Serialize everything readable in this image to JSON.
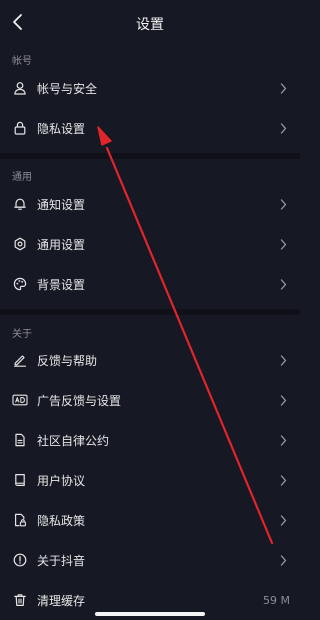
{
  "header": {
    "title": "设置"
  },
  "sections": {
    "account": "帐号",
    "general": "通用",
    "about": "关于"
  },
  "rows": {
    "account_security": "帐号与安全",
    "privacy_settings": "隐私设置",
    "notification_settings": "通知设置",
    "general_settings": "通用设置",
    "background_settings": "背景设置",
    "feedback_help": "反馈与帮助",
    "ad_feedback_settings": "广告反馈与设置",
    "community_guidelines": "社区自律公约",
    "user_agreement": "用户协议",
    "privacy_policy": "隐私政策",
    "about_douyin": "关于抖音",
    "clear_cache": "清理缓存",
    "cache_size": "59 M"
  },
  "icons": {
    "back": "chevron-left-icon",
    "account_security": "user-icon",
    "privacy_settings": "lock-icon",
    "notification_settings": "bell-icon",
    "general_settings": "gear-icon",
    "background_settings": "palette-icon",
    "feedback_help": "pencil-icon",
    "ad_feedback_settings": "ad-icon",
    "community_guidelines": "document-icon",
    "user_agreement": "book-icon",
    "privacy_policy": "document-lock-icon",
    "about_douyin": "info-icon",
    "clear_cache": "trash-icon",
    "chevron": "chevron-right-icon"
  },
  "colors": {
    "background": "#161823",
    "divider": "#0f1018",
    "text": "#e6e6e8",
    "muted": "#8c8d93",
    "annotation_arrow": "#e0252b"
  }
}
